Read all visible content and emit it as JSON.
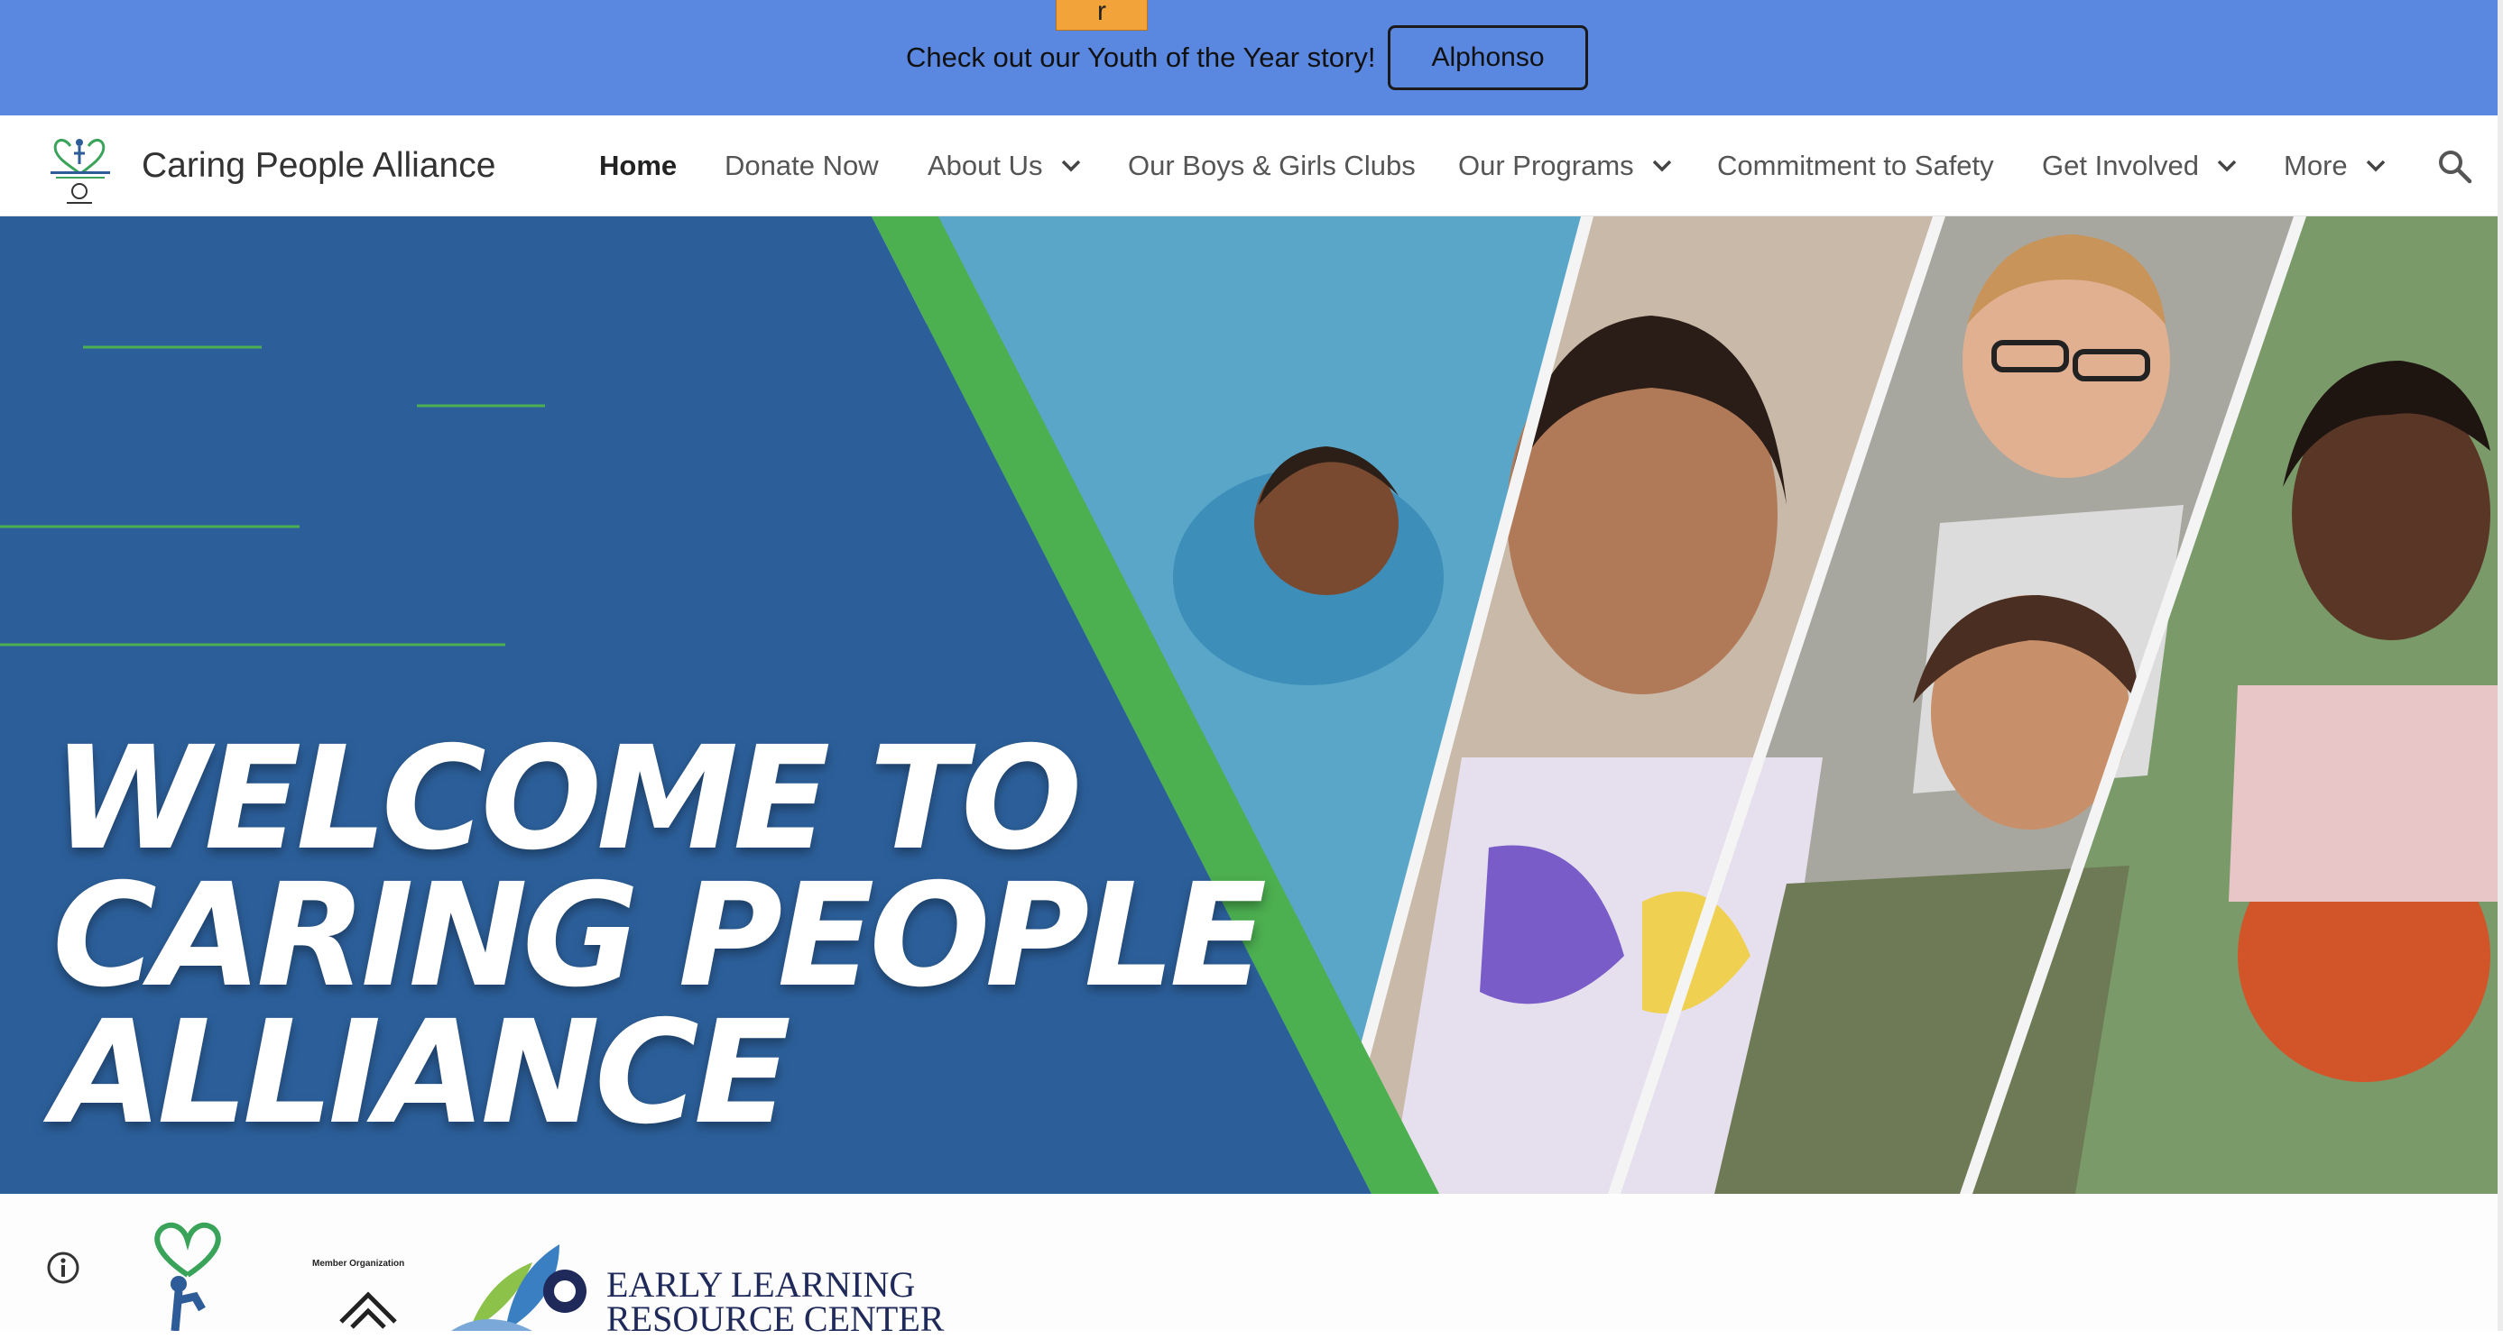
{
  "banner": {
    "skip_tab": "r",
    "text": "Check out our Youth of the Year story!",
    "button_label": "Alphonso"
  },
  "site": {
    "title": "Caring People Alliance"
  },
  "nav": {
    "items": [
      {
        "label": "Home",
        "active": true,
        "dropdown": false
      },
      {
        "label": "Donate Now",
        "dropdown": false
      },
      {
        "label": "About Us",
        "dropdown": true
      },
      {
        "label": "Our Boys & Girls Clubs",
        "dropdown": false
      },
      {
        "label": "Our Programs",
        "dropdown": true
      },
      {
        "label": "Commitment to Safety",
        "dropdown": false
      },
      {
        "label": "Get Involved",
        "dropdown": true
      },
      {
        "label": "More",
        "dropdown": true
      }
    ],
    "search_icon": "search-icon"
  },
  "hero": {
    "headline_lines": [
      "WELCOME TO",
      "CARING PEOPLE",
      "ALLIANCE"
    ],
    "colors": {
      "panel": "#2c5f9a",
      "stripe": "#4caf50",
      "accent_lines": "#4caf50"
    }
  },
  "footer_strip": {
    "member_org": "Member Organization",
    "elrc_lines": [
      "EARLY LEARNING",
      "RESOURCE CENTER"
    ],
    "info_icon": "info-icon"
  },
  "colors": {
    "banner": "#5a87e0",
    "nav_text": "#555555",
    "title_text": "#333333"
  }
}
